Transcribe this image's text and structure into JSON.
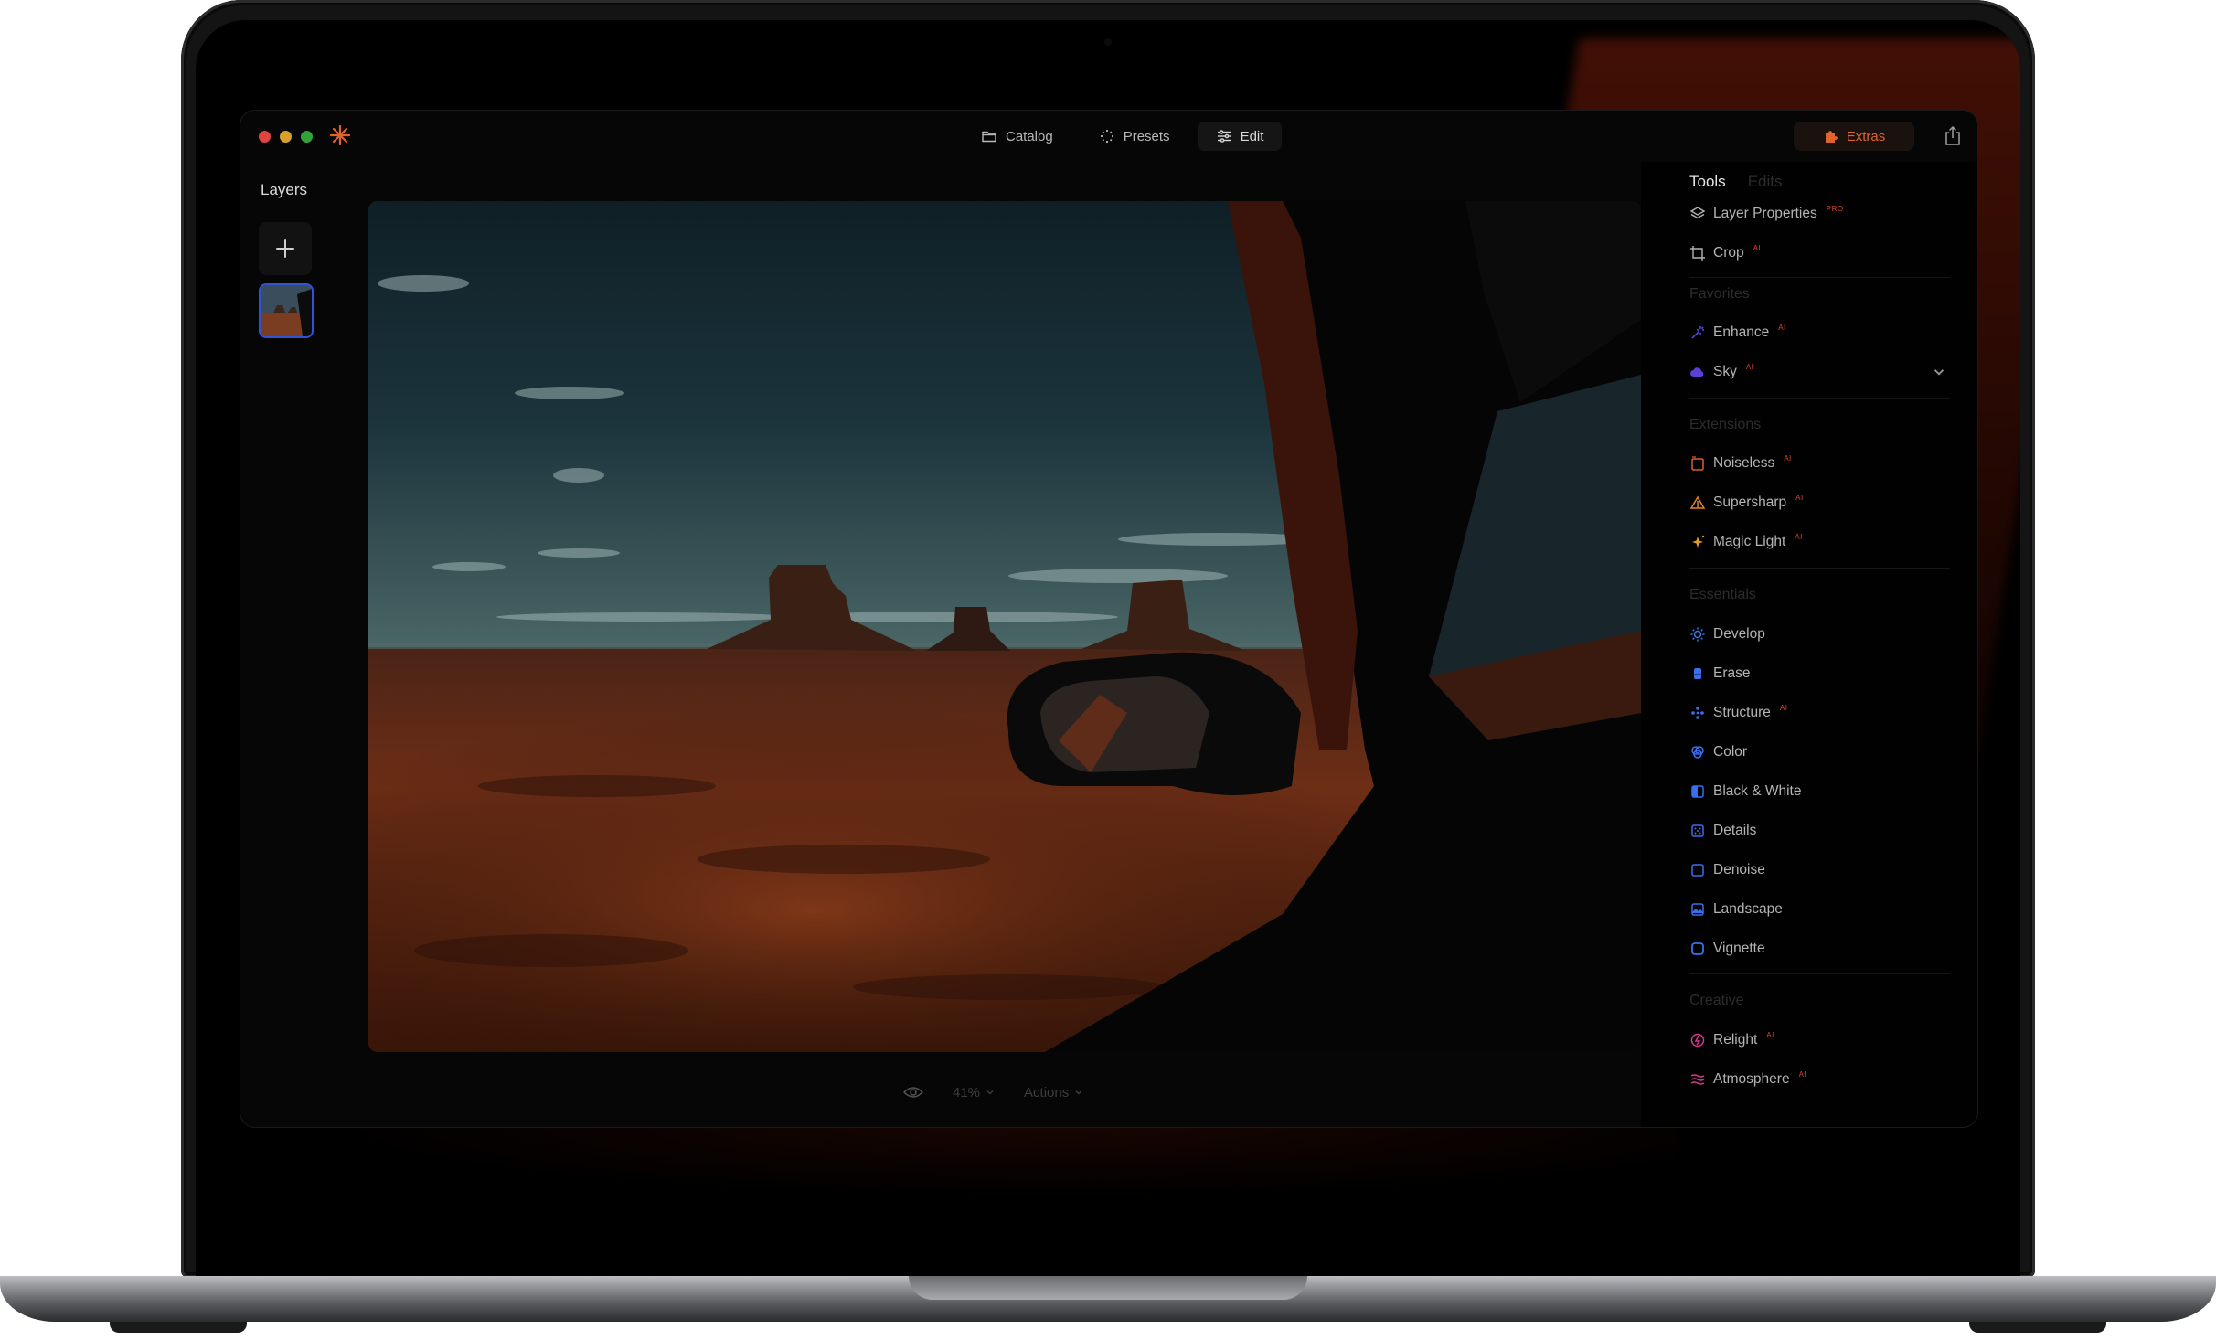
{
  "window": {
    "nav_tabs": [
      {
        "label": "Catalog",
        "icon": "folder-icon"
      },
      {
        "label": "Presets",
        "icon": "sparkle-icon"
      },
      {
        "label": "Edit",
        "icon": "sliders-icon"
      }
    ],
    "active_tab": "Edit",
    "extras_label": "Extras"
  },
  "layers": {
    "title": "Layers"
  },
  "bottom_bar": {
    "zoom_label": "41%",
    "actions_label": "Actions"
  },
  "tools_panel": {
    "tabs": {
      "tools": "Tools",
      "edits": "Edits"
    },
    "top_items": [
      {
        "label": "Layer Properties",
        "badge": "PRO",
        "icon": "layers-icon"
      },
      {
        "label": "Crop",
        "badge": "AI",
        "icon": "crop-icon"
      }
    ],
    "sections": {
      "favorites": "Favorites",
      "extensions": "Extensions",
      "essentials": "Essentials",
      "creative": "Creative"
    },
    "favorites": [
      {
        "label": "Enhance",
        "badge": "AI",
        "icon": "enhance-icon"
      },
      {
        "label": "Sky",
        "badge": "AI",
        "icon": "cloud-icon"
      }
    ],
    "extensions": [
      {
        "label": "Noiseless",
        "badge": "AI",
        "icon": "noiseless-icon"
      },
      {
        "label": "Supersharp",
        "badge": "AI",
        "icon": "supersharp-icon"
      },
      {
        "label": "Magic Light",
        "badge": "AI",
        "icon": "magic-light-icon"
      }
    ],
    "essentials": [
      {
        "label": "Develop",
        "icon": "sun-icon"
      },
      {
        "label": "Erase",
        "icon": "eraser-icon"
      },
      {
        "label": "Structure",
        "badge": "AI",
        "icon": "structure-icon"
      },
      {
        "label": "Color",
        "icon": "color-icon"
      },
      {
        "label": "Black & White",
        "icon": "black-white-icon"
      },
      {
        "label": "Details",
        "icon": "details-icon"
      },
      {
        "label": "Denoise",
        "icon": "denoise-icon"
      },
      {
        "label": "Landscape",
        "icon": "landscape-icon"
      },
      {
        "label": "Vignette",
        "icon": "vignette-icon"
      }
    ],
    "creative": [
      {
        "label": "Relight",
        "badge": "AI",
        "icon": "relight-icon"
      },
      {
        "label": "Atmosphere",
        "badge": "AI",
        "icon": "atmosphere-icon"
      }
    ]
  },
  "colors": {
    "accent_orange": "#e0622d",
    "selection_blue": "#2f52d8",
    "window_bg": "#060606"
  }
}
